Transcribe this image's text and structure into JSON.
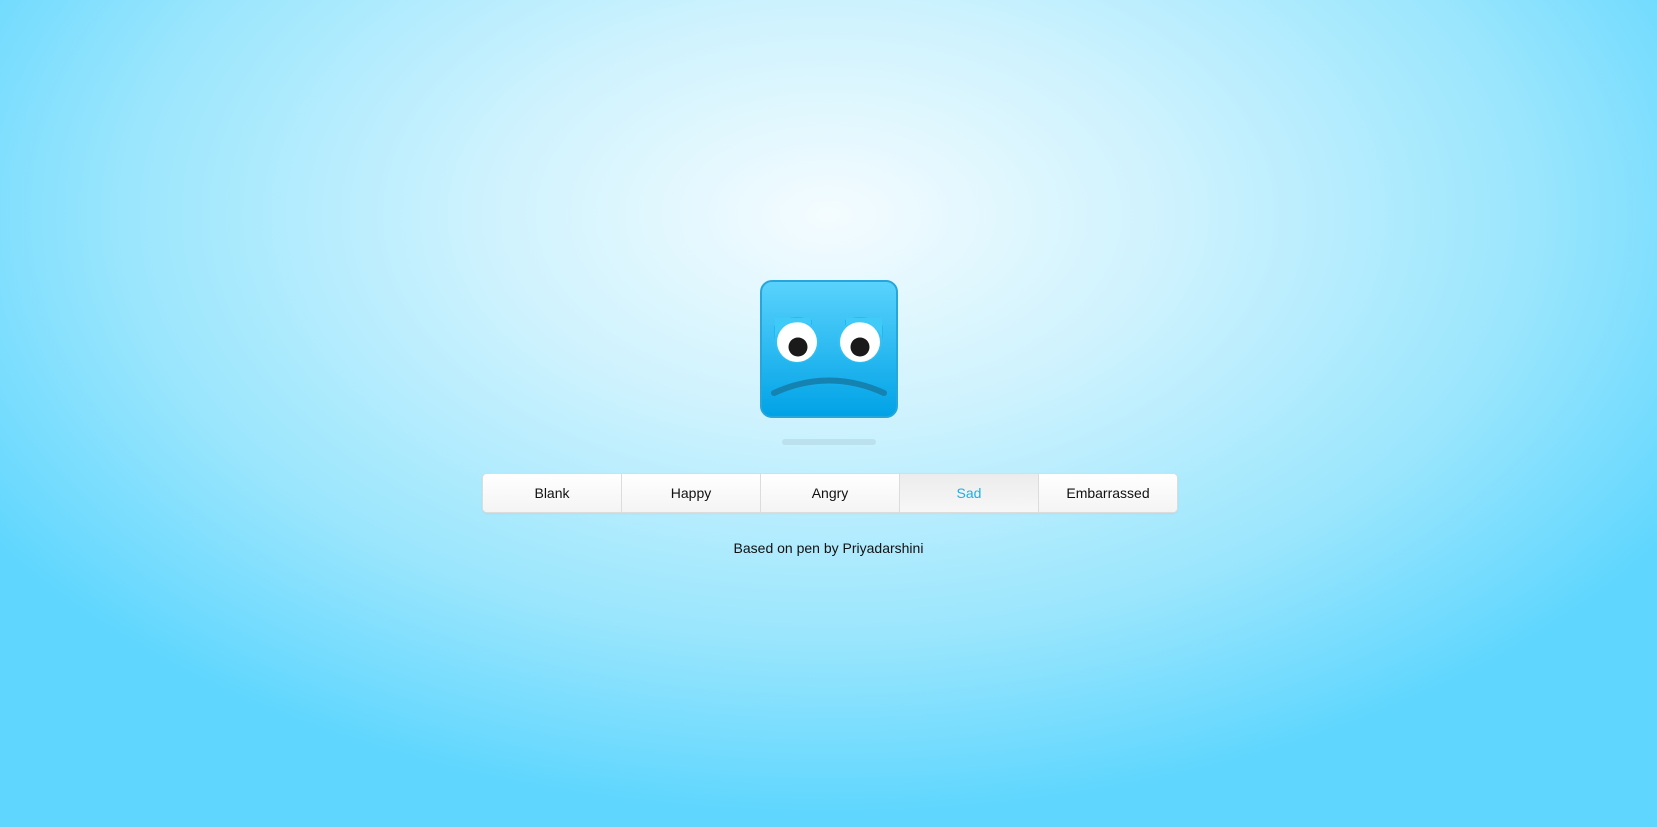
{
  "face": {
    "mood": "sad",
    "colors": {
      "top": "#5ad3fd",
      "bottom": "#00a2e6",
      "border": "#26a6da",
      "eye_white": "#ffffff",
      "pupil": "#1a1a1a",
      "mouth": "#1583b2"
    },
    "icon": "sad-face-icon"
  },
  "moods": {
    "items": [
      {
        "label": "Blank",
        "active": false
      },
      {
        "label": "Happy",
        "active": false
      },
      {
        "label": "Angry",
        "active": false
      },
      {
        "label": "Sad",
        "active": true
      },
      {
        "label": "Embarrassed",
        "active": false
      }
    ],
    "active_color": "#1ab0e8"
  },
  "credit": {
    "text": "Based on pen by Priyadarshini"
  }
}
